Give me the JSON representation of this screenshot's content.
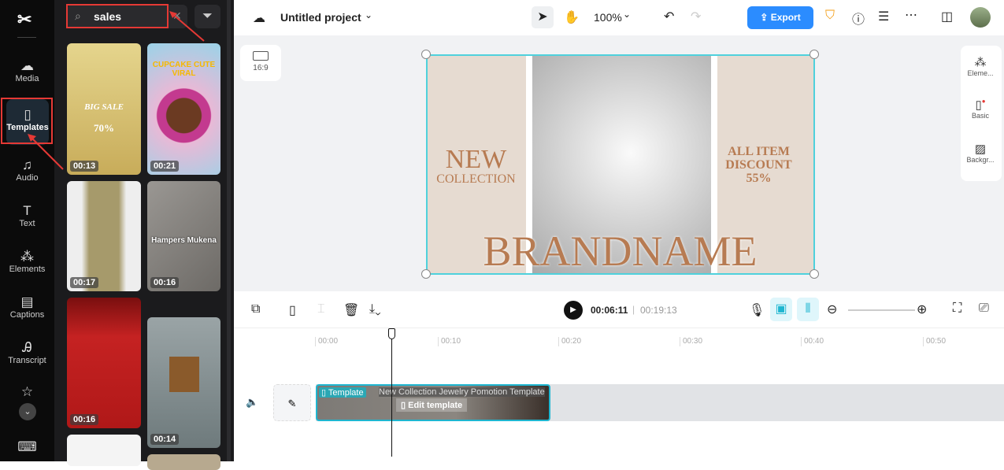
{
  "sidebar": {
    "items": [
      {
        "label": "Media",
        "icon": "cloud-upload-icon"
      },
      {
        "label": "Templates",
        "icon": "templates-icon",
        "active": true
      },
      {
        "label": "Audio",
        "icon": "music-icon"
      },
      {
        "label": "Text",
        "icon": "text-icon"
      },
      {
        "label": "Elements",
        "icon": "elements-icon"
      },
      {
        "label": "Captions",
        "icon": "captions-icon"
      },
      {
        "label": "Transcript",
        "icon": "transcript-icon"
      }
    ]
  },
  "search": {
    "value": "sales"
  },
  "templates": [
    {
      "duration": "00:13",
      "title": "BIG SALE",
      "sub": "70%",
      "bg": "#d9c27a"
    },
    {
      "duration": "00:21",
      "title": "CUPCAKE CUTE VIRAL",
      "bg": "#e8b9d6"
    },
    {
      "duration": "00:17",
      "bg": "#e9e7e2"
    },
    {
      "duration": "00:16",
      "title": "Hampers Mukena",
      "bg": "#8d8a86"
    },
    {
      "duration": "00:16",
      "bg": "#b81d1d"
    },
    {
      "duration": "00:14",
      "bg": "#7f8a8c"
    }
  ],
  "header": {
    "project": "Untitled project",
    "zoom": "100%",
    "export": "Export"
  },
  "canvas": {
    "ratio": "16:9",
    "left_title": "NEW",
    "left_sub": "COLLECTION",
    "right_text": "ALL ITEM DISCOUNT 55%",
    "brand": "BRANDNAME"
  },
  "right_panel": [
    {
      "label": "Eleme..."
    },
    {
      "label": "Basic"
    },
    {
      "label": "Backgr..."
    }
  ],
  "timeline": {
    "current": "00:06:11",
    "total": "00:19:13",
    "ticks": [
      "00:00",
      "00:10",
      "00:20",
      "00:30",
      "00:40",
      "00:50"
    ],
    "clip_badge": "Template",
    "clip_title": "New Collection Jewelry Pomotion Template",
    "edit": "Edit template"
  },
  "colors": {
    "accent": "#1fb6d0",
    "export": "#2b8cff"
  }
}
